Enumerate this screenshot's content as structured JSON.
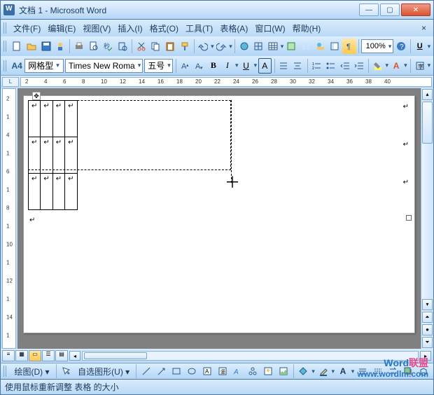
{
  "window": {
    "title": "文档 1 - Microsoft Word"
  },
  "menu": {
    "file": "文件(F)",
    "edit": "编辑(E)",
    "view": "视图(V)",
    "insert": "插入(I)",
    "format": "格式(O)",
    "tools": "工具(T)",
    "table": "表格(A)",
    "window": "窗口(W)",
    "help": "帮助(H)",
    "helpx": "×"
  },
  "toolbar": {
    "zoom": "100%"
  },
  "format": {
    "style_icon": "A4",
    "style": "网格型",
    "font": "Times New Roma",
    "size": "五号",
    "bold": "B",
    "italic": "I",
    "ul": "U",
    "A": "A"
  },
  "ruler": {
    "corner": "L",
    "ticks": [
      "2",
      "4",
      "6",
      "8",
      "10",
      "12",
      "14",
      "16",
      "18",
      "20",
      "22",
      "24",
      "26",
      "28",
      "30",
      "32",
      "34",
      "36",
      "38",
      "40"
    ]
  },
  "vruler": {
    "ticks": [
      "2",
      "1",
      "4",
      "1",
      "6",
      "1",
      "8",
      "1",
      "10",
      "1",
      "12",
      "1",
      "14",
      "1"
    ]
  },
  "cell_mark": "↵",
  "drawbar": {
    "label": "绘图(D)",
    "autoshapes": "自选图形(U)"
  },
  "status": {
    "text": "使用鼠标重新调整 表格 的大小"
  },
  "watermark": {
    "l1a": "W",
    "l1b": "ord",
    "l1c": "联盟",
    "l2": "www.wordlm.com"
  }
}
